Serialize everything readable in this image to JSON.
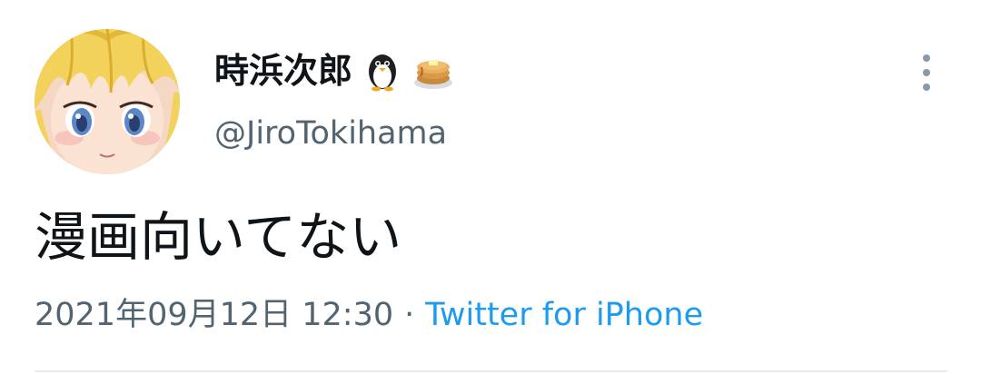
{
  "author": {
    "display_name": "時浜次郎",
    "name_emojis": [
      "penguin-emoji",
      "pancakes-emoji"
    ],
    "handle": "@JiroTokihama"
  },
  "tweet": {
    "text": "漫画向いてない",
    "timestamp": "2021年09月12日 12:30",
    "separator": "·",
    "source": "Twitter for iPhone"
  },
  "colors": {
    "text": "#0f1419",
    "secondary": "#536471",
    "link": "#1d9bf0",
    "divider": "#e6ecf0"
  }
}
